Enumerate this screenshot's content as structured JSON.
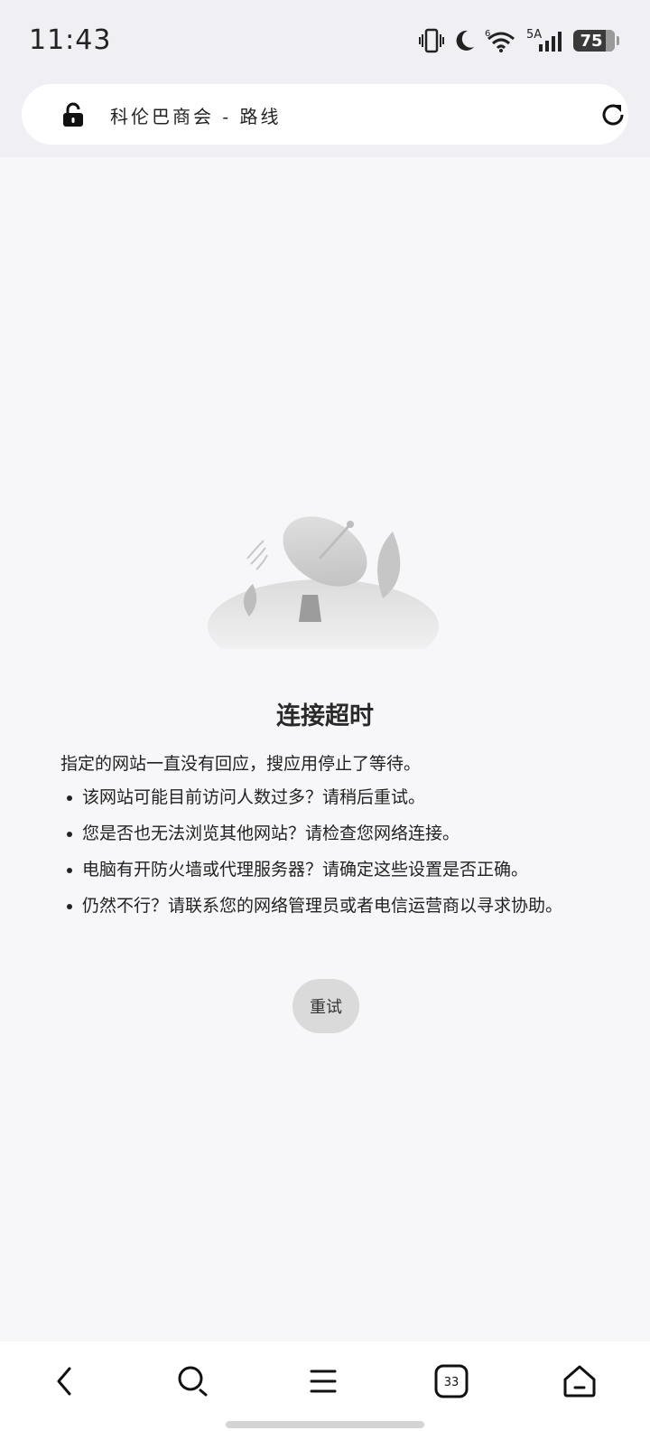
{
  "status_bar": {
    "time": "11:43",
    "network_label": "5A",
    "wifi_label": "6",
    "battery_level": "75"
  },
  "address_bar": {
    "title": "科伦巴商会 - 路线"
  },
  "error": {
    "title": "连接超时",
    "description": "指定的网站一直没有回应，搜应用停止了等待。",
    "bullets": [
      "该网站可能目前访问人数过多？请稍后重试。",
      "您是否也无法浏览其他网站？请检查您网络连接。",
      "电脑有开防火墙或代理服务器？请确定这些设置是否正确。",
      "仍然不行？请联系您的网络管理员或者电信运营商以寻求协助。"
    ],
    "retry_label": "重试"
  },
  "bottom_nav": {
    "tab_count": "33"
  }
}
